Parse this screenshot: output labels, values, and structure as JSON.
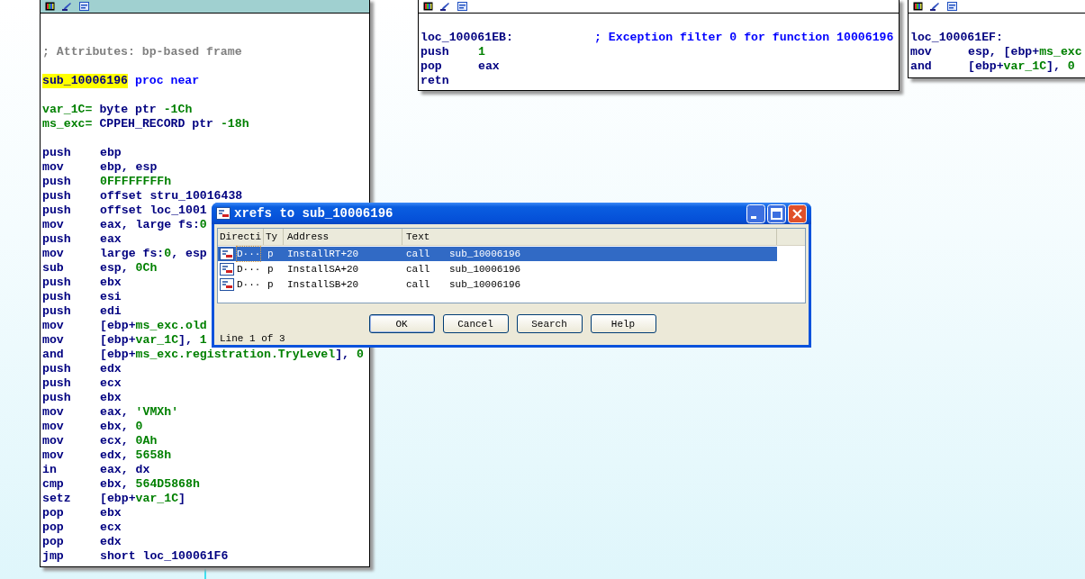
{
  "nodes": [
    {
      "selected": true,
      "blocks": [
        [
          {
            "kind": "comment",
            "text": "; Attributes: bp-based frame"
          }
        ],
        [
          {
            "kind": "proc",
            "name": "sub_10006196",
            "highlighted": true,
            "rest": "proc near"
          }
        ],
        [
          {
            "kind": "var",
            "name": "var_1C=",
            "ops": [
              {
                "t": "byte ptr ",
                "color": "#000080"
              },
              {
                "t": "-1Ch",
                "color": "#008000"
              }
            ]
          },
          {
            "kind": "var",
            "name": "ms_exc=",
            "ops": [
              {
                "t": "CPPEH_RECORD ptr ",
                "color": "#000080"
              },
              {
                "t": "-18h",
                "color": "#008000"
              }
            ]
          }
        ],
        [
          {
            "kind": "insn",
            "mnem": "push",
            "ops": [
              {
                "t": "ebp",
                "color": "#000080"
              }
            ]
          },
          {
            "kind": "insn",
            "mnem": "mov",
            "ops": [
              {
                "t": "ebp, esp",
                "color": "#000080"
              }
            ]
          },
          {
            "kind": "insn",
            "mnem": "push",
            "ops": [
              {
                "t": "0FFFFFFFFh",
                "color": "#008000"
              }
            ]
          },
          {
            "kind": "insn",
            "mnem": "push",
            "ops": [
              {
                "t": "offset stru_10016438",
                "color": "#000080"
              }
            ]
          },
          {
            "kind": "insn",
            "mnem": "push",
            "ops": [
              {
                "t": "offset loc_1001",
                "color": "#000080"
              }
            ]
          },
          {
            "kind": "insn",
            "mnem": "mov",
            "ops": [
              {
                "t": "eax, large fs:",
                "color": "#000080"
              },
              {
                "t": "0",
                "color": "#008000"
              }
            ]
          },
          {
            "kind": "insn",
            "mnem": "push",
            "ops": [
              {
                "t": "eax",
                "color": "#000080"
              }
            ]
          },
          {
            "kind": "insn",
            "mnem": "mov",
            "ops": [
              {
                "t": "large fs:",
                "color": "#000080"
              },
              {
                "t": "0",
                "color": "#008000"
              },
              {
                "t": ", esp",
                "color": "#000080"
              }
            ]
          },
          {
            "kind": "insn",
            "mnem": "sub",
            "ops": [
              {
                "t": "esp, ",
                "color": "#000080"
              },
              {
                "t": "0Ch",
                "color": "#008000"
              }
            ]
          },
          {
            "kind": "insn",
            "mnem": "push",
            "ops": [
              {
                "t": "ebx",
                "color": "#000080"
              }
            ]
          },
          {
            "kind": "insn",
            "mnem": "push",
            "ops": [
              {
                "t": "esi",
                "color": "#000080"
              }
            ]
          },
          {
            "kind": "insn",
            "mnem": "push",
            "ops": [
              {
                "t": "edi",
                "color": "#000080"
              }
            ]
          },
          {
            "kind": "insn",
            "mnem": "mov",
            "ops": [
              {
                "t": "[ebp+",
                "color": "#000080"
              },
              {
                "t": "ms_exc.old",
                "color": "#008000"
              }
            ]
          },
          {
            "kind": "insn",
            "mnem": "mov",
            "ops": [
              {
                "t": "[ebp+",
                "color": "#000080"
              },
              {
                "t": "var_1C",
                "color": "#008000"
              },
              {
                "t": "], ",
                "color": "#000080"
              },
              {
                "t": "1",
                "color": "#008000"
              }
            ]
          },
          {
            "kind": "insn",
            "mnem": "and",
            "ops": [
              {
                "t": "[ebp+",
                "color": "#000080"
              },
              {
                "t": "ms_exc.registration.TryLevel",
                "color": "#008000"
              },
              {
                "t": "], ",
                "color": "#000080"
              },
              {
                "t": "0",
                "color": "#008000"
              }
            ]
          },
          {
            "kind": "insn",
            "mnem": "push",
            "ops": [
              {
                "t": "edx",
                "color": "#000080"
              }
            ]
          },
          {
            "kind": "insn",
            "mnem": "push",
            "ops": [
              {
                "t": "ecx",
                "color": "#000080"
              }
            ]
          },
          {
            "kind": "insn",
            "mnem": "push",
            "ops": [
              {
                "t": "ebx",
                "color": "#000080"
              }
            ]
          },
          {
            "kind": "insn",
            "mnem": "mov",
            "ops": [
              {
                "t": "eax, ",
                "color": "#000080"
              },
              {
                "t": "'VMXh'",
                "color": "#008000"
              }
            ]
          },
          {
            "kind": "insn",
            "mnem": "mov",
            "ops": [
              {
                "t": "ebx, ",
                "color": "#000080"
              },
              {
                "t": "0",
                "color": "#008000"
              }
            ]
          },
          {
            "kind": "insn",
            "mnem": "mov",
            "ops": [
              {
                "t": "ecx, ",
                "color": "#000080"
              },
              {
                "t": "0Ah",
                "color": "#008000"
              }
            ]
          },
          {
            "kind": "insn",
            "mnem": "mov",
            "ops": [
              {
                "t": "edx, ",
                "color": "#000080"
              },
              {
                "t": "5658h",
                "color": "#008000"
              }
            ]
          },
          {
            "kind": "insn",
            "mnem": "in",
            "ops": [
              {
                "t": "eax, dx",
                "color": "#000080"
              }
            ]
          },
          {
            "kind": "insn",
            "mnem": "cmp",
            "ops": [
              {
                "t": "ebx, ",
                "color": "#000080"
              },
              {
                "t": "564D5868h",
                "color": "#008000"
              }
            ]
          },
          {
            "kind": "insn",
            "mnem": "setz",
            "ops": [
              {
                "t": "[ebp+",
                "color": "#000080"
              },
              {
                "t": "var_1C",
                "color": "#008000"
              },
              {
                "t": "]",
                "color": "#000080"
              }
            ]
          },
          {
            "kind": "insn",
            "mnem": "pop",
            "ops": [
              {
                "t": "ebx",
                "color": "#000080"
              }
            ]
          },
          {
            "kind": "insn",
            "mnem": "pop",
            "ops": [
              {
                "t": "ecx",
                "color": "#000080"
              }
            ]
          },
          {
            "kind": "insn",
            "mnem": "pop",
            "ops": [
              {
                "t": "edx",
                "color": "#000080"
              }
            ]
          },
          {
            "kind": "insn",
            "mnem": "jmp",
            "ops": [
              {
                "t": "short loc_100061F6",
                "color": "#000080"
              }
            ]
          }
        ]
      ]
    },
    {
      "selected": false,
      "blocks": [
        [
          {
            "kind": "label",
            "name": "loc_100061EB:",
            "comment": "; Exception filter 0 for function 10006196"
          },
          {
            "kind": "insn",
            "mnem": "push",
            "ops": [
              {
                "t": "1",
                "color": "#008000"
              }
            ]
          },
          {
            "kind": "insn",
            "mnem": "pop",
            "ops": [
              {
                "t": "eax",
                "color": "#000080"
              }
            ]
          },
          {
            "kind": "insn",
            "mnem": "retn"
          }
        ]
      ]
    },
    {
      "selected": false,
      "blocks": [
        [
          {
            "kind": "label",
            "name": "loc_100061EF:"
          },
          {
            "kind": "insn",
            "mnem": "mov",
            "ops": [
              {
                "t": "esp, [ebp+",
                "color": "#000080"
              },
              {
                "t": "ms_exc",
                "color": "#008000"
              }
            ]
          },
          {
            "kind": "insn",
            "mnem": "and",
            "ops": [
              {
                "t": "[ebp+",
                "color": "#000080"
              },
              {
                "t": "var_1C",
                "color": "#008000"
              },
              {
                "t": "], ",
                "color": "#000080"
              },
              {
                "t": "0",
                "color": "#008000"
              }
            ]
          }
        ]
      ]
    }
  ],
  "dialog": {
    "title": "xrefs to sub_10006196",
    "columns": [
      "Directi",
      "Ty",
      "Address",
      "Text"
    ],
    "rows": [
      {
        "direction": "D···",
        "type": "p",
        "address": "InstallRT+20",
        "text": "call",
        "target": "sub_10006196",
        "selected": true
      },
      {
        "direction": "D···",
        "type": "p",
        "address": "InstallSA+20",
        "text": "call",
        "target": "sub_10006196",
        "selected": false
      },
      {
        "direction": "D···",
        "type": "p",
        "address": "InstallSB+20",
        "text": "call",
        "target": "sub_10006196",
        "selected": false
      }
    ],
    "buttons": [
      "OK",
      "Cancel",
      "Search",
      "Help"
    ],
    "status": "Line 1 of 3"
  }
}
